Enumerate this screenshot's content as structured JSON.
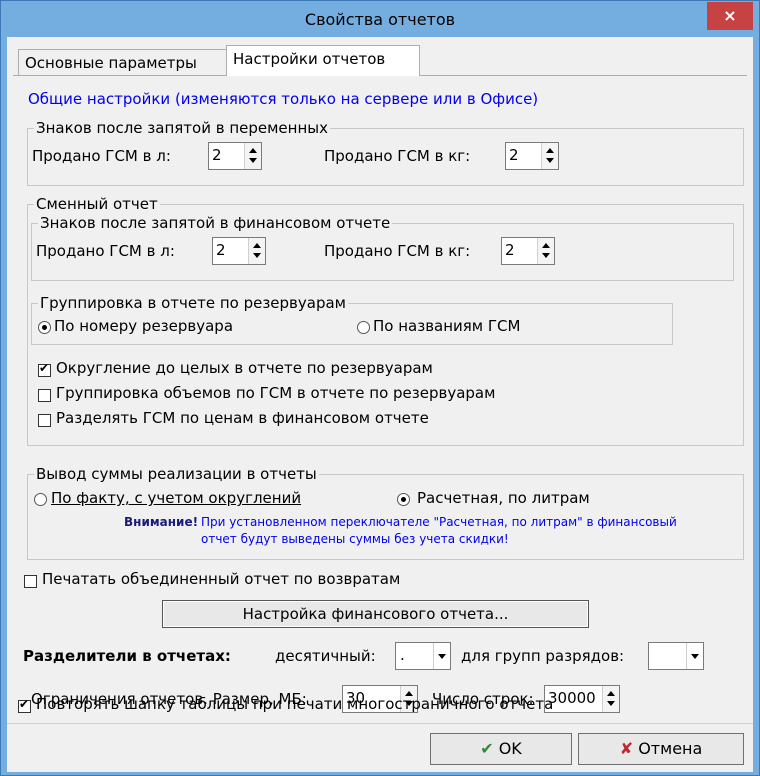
{
  "window": {
    "title": "Свойства отчетов",
    "close_symbol": "×"
  },
  "tabs": [
    {
      "label": "Основные параметры"
    },
    {
      "label": "Настройки отчетов"
    }
  ],
  "note": "Общие настройки (изменяются только на сервере или в Офисе)",
  "group_vars": {
    "title": "Знаков после запятой в переменных",
    "sold_l_label": "Продано ГСМ в л:",
    "sold_l_value": "2",
    "sold_kg_label": "Продано ГСМ в кг:",
    "sold_kg_value": "2"
  },
  "group_shift": {
    "title": "Сменный отчет",
    "fin_title": "Знаков после запятой в финансовом отчете",
    "sold_l_label": "Продано ГСМ в л:",
    "sold_l_value": "2",
    "sold_kg_label": "Продано ГСМ в кг:",
    "sold_kg_value": "2",
    "grouping_title": "Группировка в отчете по резервуарам",
    "radio_by_number": "По номеру резервуара",
    "radio_by_name": "По названиям ГСМ",
    "cb_round": "Округление до целых в отчете по резервуарам",
    "cb_group_volumes": "Группировка объемов по ГСМ в отчете по резервуарам",
    "cb_split_prices": "Разделять ГСМ по ценам в финансовом отчете"
  },
  "group_sum": {
    "title": "Вывод суммы реализации в отчеты",
    "radio_fact": "По факту, с учетом округлений",
    "radio_calc": "Расчетная, по литрам",
    "attention": "Внимание!",
    "warning_line1": "При установленном переключателе \"Расчетная, по литрам\" в финансовый",
    "warning_line2": "отчет будут выведены суммы без учета скидки!"
  },
  "cb_print_combined": "Печатать объединенный отчет по возвратам",
  "btn_fin_settings": "Настройка финансового отчета...",
  "separators": {
    "label": "Разделители в отчетах:",
    "decimal_label": "десятичный:",
    "decimal_value": ".",
    "group_label": "для групп разрядов:",
    "group_value": ""
  },
  "limits": {
    "label": "Ограничения отчетов. Размер, МБ:",
    "size_value": "30",
    "rows_label": "Число строк:",
    "rows_value": "30000"
  },
  "cb_repeat_header": "Повторять шапку таблицы при печати многостраничного отчета",
  "buttons": {
    "ok": "OK",
    "cancel": "Отмена",
    "ok_check": "✔",
    "cancel_x": "✘"
  },
  "colors": {
    "title_bg": "#74aee0",
    "close_bg": "#c74343",
    "link_blue": "#0000ee",
    "ok_green": "#2e8b2e",
    "cancel_red": "#c0282d"
  }
}
